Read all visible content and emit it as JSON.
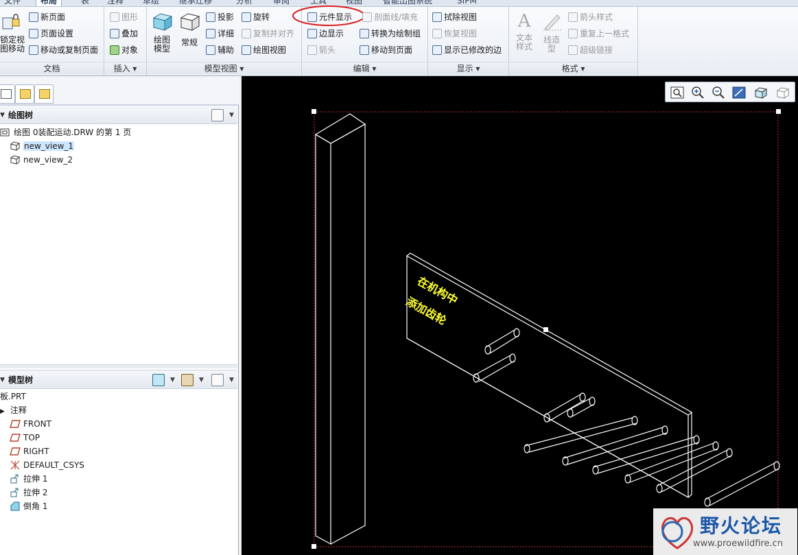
{
  "tabs": [
    "文件",
    "布局",
    "表",
    "注释",
    "草绘",
    "继承迁移",
    "分析",
    "审阅",
    "工具",
    "视图",
    "智能出图系统",
    "SIPM"
  ],
  "ribbon": {
    "doc": {
      "lock_view_label_1": "锁定视",
      "lock_view_label_2": "图移动",
      "new_page": "新页面",
      "page_setup": "页面设置",
      "move_copy_page": "移动或复制页面",
      "group_label": "文档"
    },
    "insert": {
      "graphics": "图形",
      "overlay": "叠加",
      "object": "对象",
      "group_label": "插入"
    },
    "model_views": {
      "drawing_model_1": "绘图",
      "drawing_model_2": "模型",
      "general": "常规",
      "projection": "投影",
      "detail": "详细",
      "auxiliary": "辅助",
      "rotate": "旋转",
      "copy_align": "复制并对齐",
      "drawing_view": "绘图视图",
      "group_label": "模型视图"
    },
    "edit": {
      "component_display": "元件显示",
      "section_line_fill": "剖面线/填充",
      "edge_display": "边显示",
      "convert_draw_group": "转换为绘制组",
      "arrow": "箭头",
      "move_to_page": "移动到页面",
      "group_label": "编辑"
    },
    "display": {
      "erase_view": "拭除视图",
      "restore_view": "恢复视图",
      "show_modified_edges": "显示已修改的边",
      "group_label": "显示"
    },
    "format": {
      "text_style_1": "文本",
      "text_style_2": "样式",
      "line_style_1": "线造",
      "line_style_2": "型",
      "arrow_style": "箭头样式",
      "repeat_last_format": "重复上一格式",
      "hyperlink": "超级链接",
      "group_label": "格式"
    }
  },
  "drawing_tree": {
    "title": "绘图树",
    "root": "绘图 0装配运动.DRW 的第 1 页",
    "views": [
      "new_view_1",
      "new_view_2"
    ]
  },
  "model_tree": {
    "title": "模型树",
    "root": "板.PRT",
    "items": [
      "注释",
      "FRONT",
      "TOP",
      "RIGHT",
      "DEFAULT_CSYS",
      "拉伸 1",
      "拉伸 2",
      "倒角 1"
    ]
  },
  "canvas": {
    "note_line_1": "在机构中",
    "note_line_2": "添加齿轮",
    "watermark_title": "野火论坛",
    "watermark_url": "www.proewildfire.cn"
  },
  "colors": {
    "canvas_bg": "#000000",
    "model_lines": "#ffffff",
    "note_text": "#ffff33",
    "frame_dashed": "#cc3333",
    "highlight_circle": "#d81e1e",
    "selection": "#cde6ff"
  }
}
